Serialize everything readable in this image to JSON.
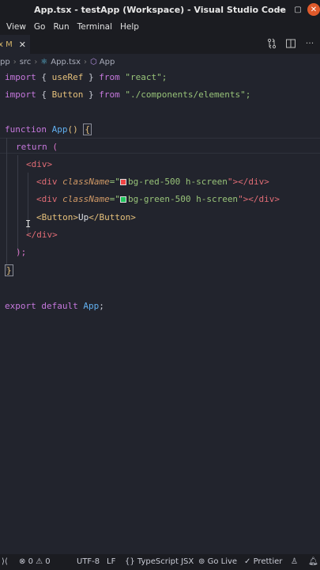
{
  "window": {
    "title": "App.tsx - testApp (Workspace) - Visual Studio Code"
  },
  "menu": [
    "View",
    "Go",
    "Run",
    "Terminal",
    "Help"
  ],
  "tab": {
    "label": "x M",
    "close": "✕"
  },
  "breadcrumb": {
    "root": "pp",
    "folder": "src",
    "file": "App.tsx",
    "symbol": "App"
  },
  "code": {
    "l1_import": "import",
    "l1_open": "{",
    "l1_name": "useRef",
    "l1_close": "}",
    "l1_from": "from",
    "l1_src": "\"react\";",
    "l2_import": "import",
    "l2_open": "{",
    "l2_name": "Button",
    "l2_close": "}",
    "l2_from": "from",
    "l2_src": "\"./components/elements\";",
    "l4_function": "function",
    "l4_name": "App",
    "l4_parens": "()",
    "l4_brace": "{",
    "l5_return": "return",
    "l5_paren": "(",
    "l6_tag": "<div>",
    "l7_open": "<div",
    "l7_attr": "className",
    "l7_eq": "=\"",
    "l7_val": "bg-red-500 h-screen",
    "l7_end": "\"></div>",
    "l8_open": "<div",
    "l8_attr": "className",
    "l8_eq": "=\"",
    "l8_val": "bg-green-500 h-screen",
    "l8_end": "\"></div>",
    "l9_open": "<Button>",
    "l9_text": "Up",
    "l9_close": "</Button>",
    "l10_tag": "</div>",
    "l11_paren": ");",
    "l12_brace": "}",
    "l14_export": "export",
    "l14_default": "default",
    "l14_name": "App",
    "l14_semi": ";"
  },
  "colors": {
    "red_swatch": "#ef4444",
    "green_swatch": "#22c55e"
  },
  "status": {
    "errors": "0",
    "warnings": "0",
    "encoding": "UTF-8",
    "eol": "LF",
    "language": "TypeScript JSX",
    "golive": "Go Live",
    "prettier": "Prettier"
  }
}
